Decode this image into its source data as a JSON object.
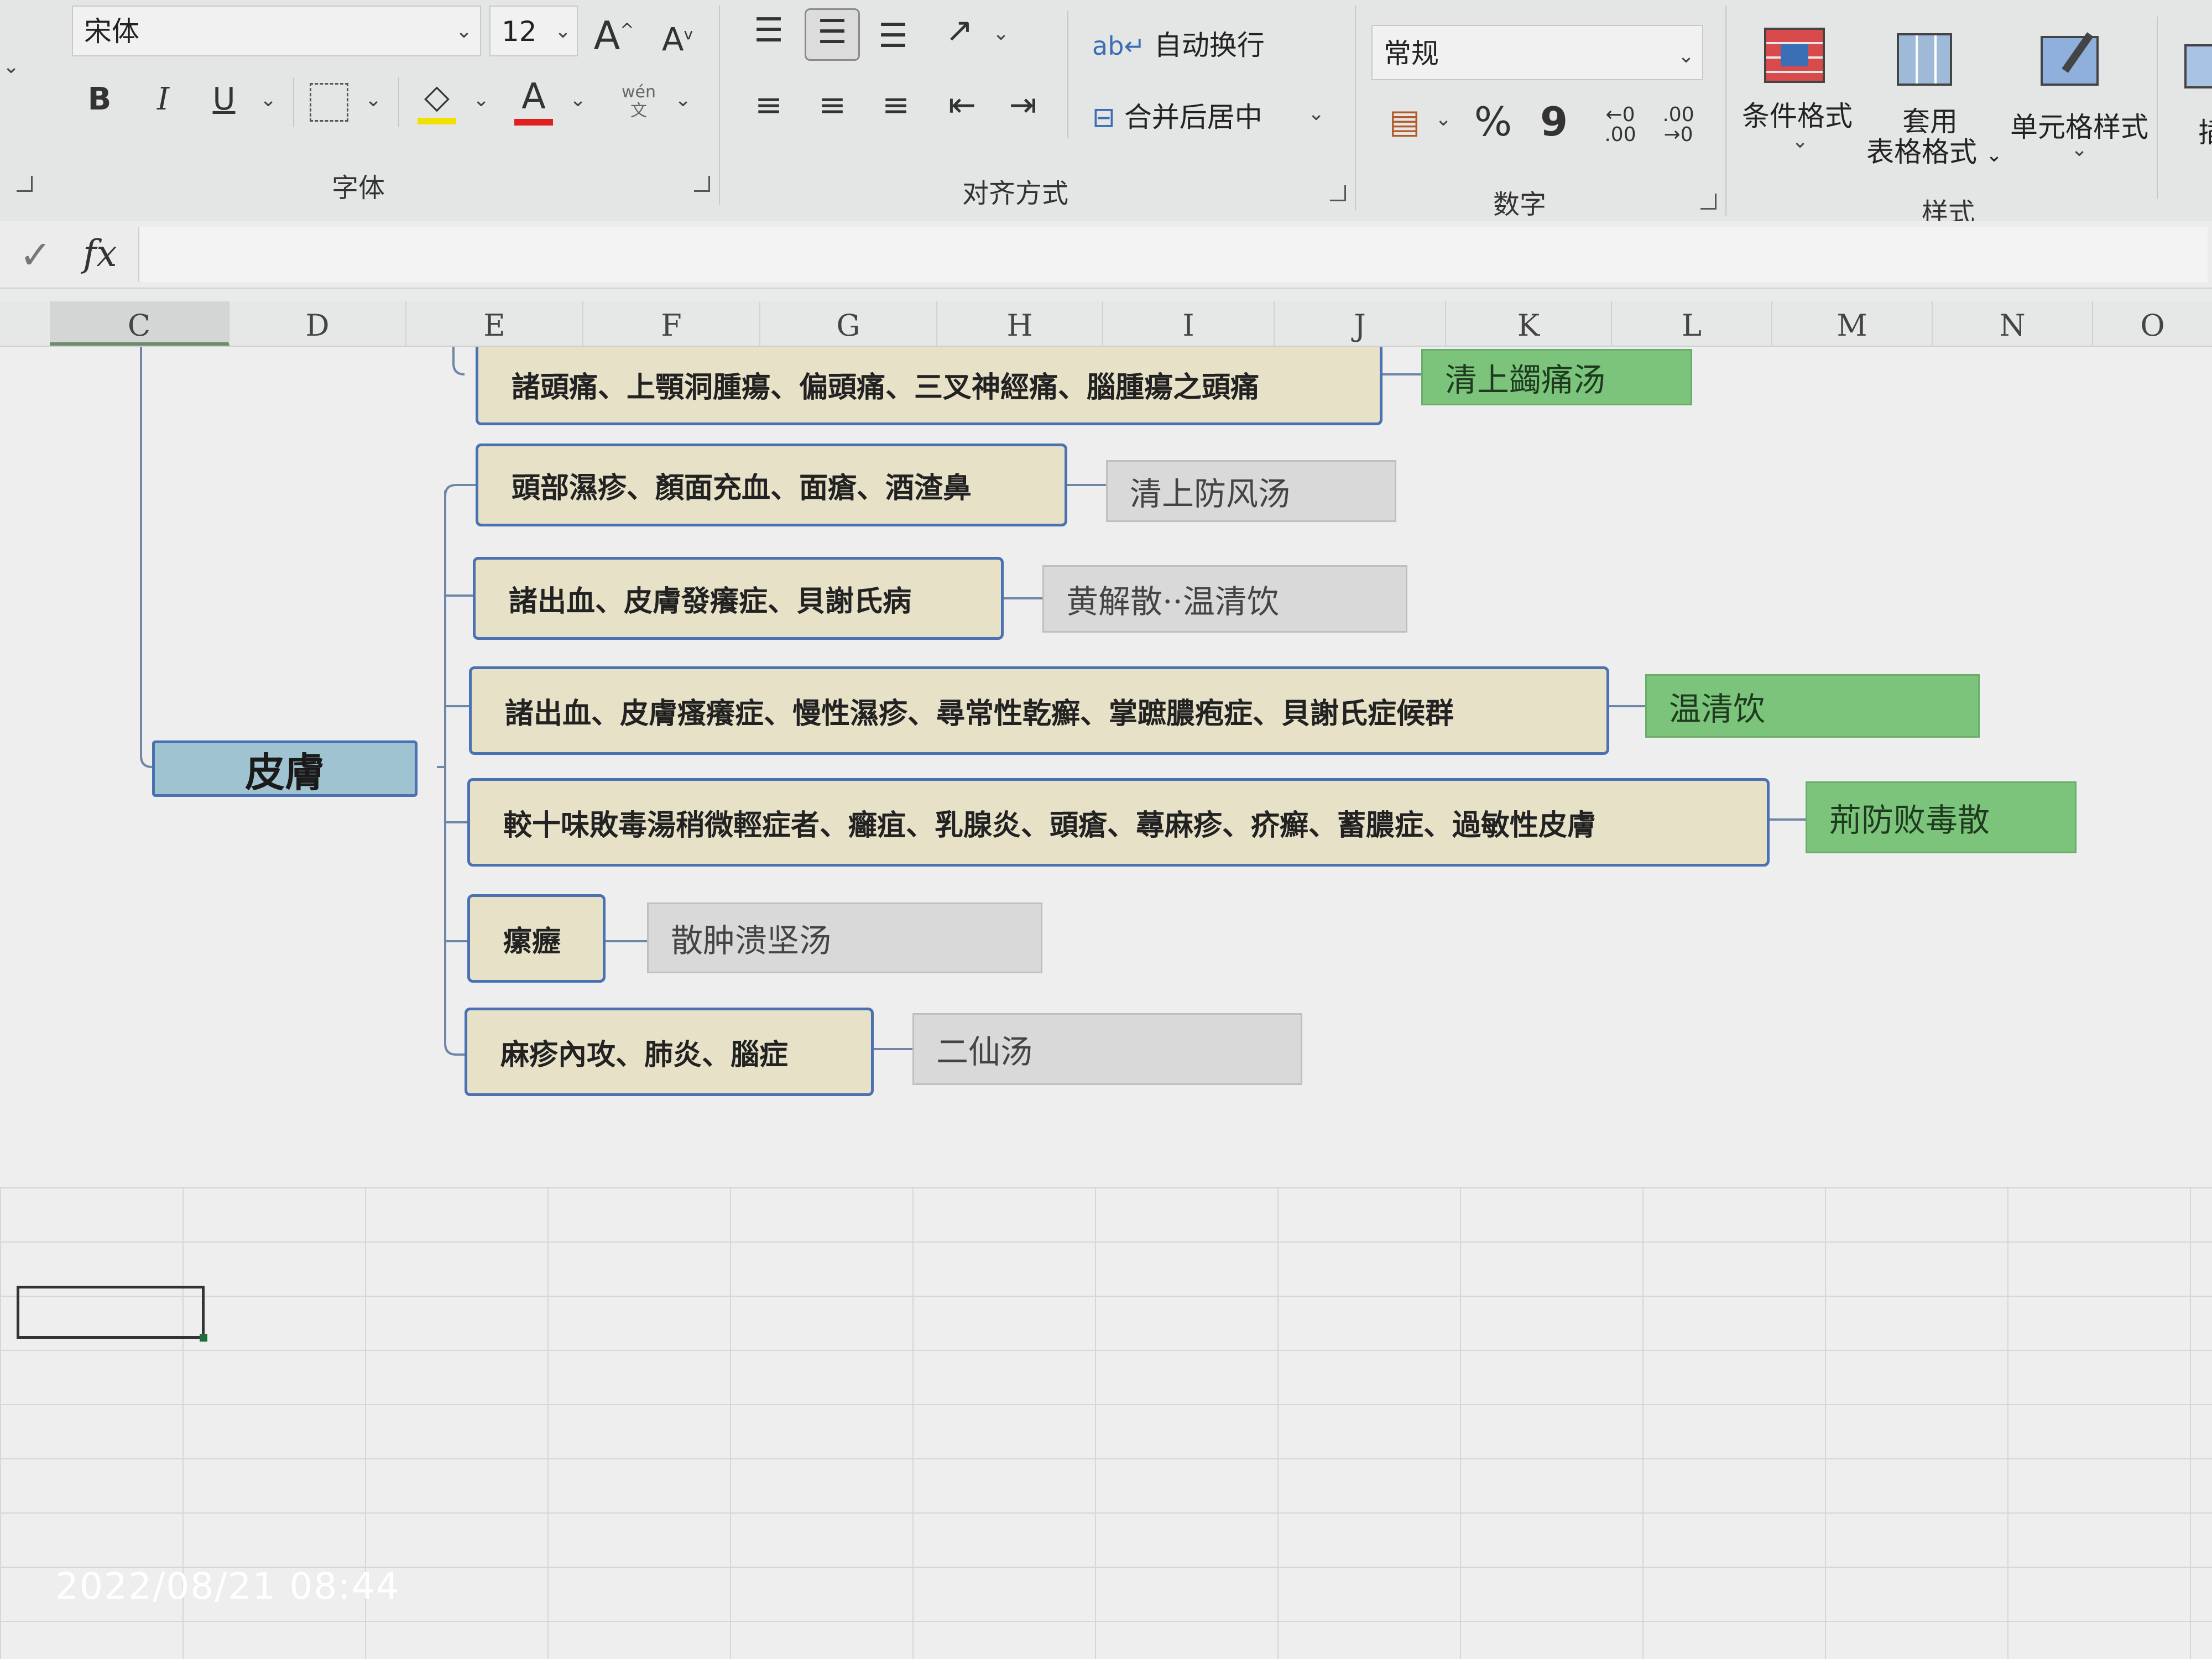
{
  "ribbon": {
    "font_name": "宋体",
    "font_size": "12",
    "grow_font_label": "A",
    "shrink_font_label": "A",
    "bold_label": "B",
    "italic_label": "I",
    "underline_label": "U",
    "font_color_label": "A",
    "phonetic_label": "wén",
    "phonetic_sub": "文",
    "wrap_text_label": "自动换行",
    "merge_center_label": "合并后居中",
    "number_format": "常规",
    "percent_label": "%",
    "comma_label": "9",
    "groups": {
      "font": "字体",
      "alignment": "对齐方式",
      "number": "数字",
      "styles": "样式"
    },
    "conditional_format_label": "条件格式",
    "table_format_label_1": "套用",
    "table_format_label_2": "表格格式",
    "cell_styles_label": "单元格样式",
    "insert_label_partial": "插",
    "colors": {
      "font_color_underline": "#e02020",
      "highlight_underline": "#f1e000"
    }
  },
  "formula_bar": {
    "fx_label": "fx",
    "check_label": "✓"
  },
  "columns": [
    "C",
    "D",
    "E",
    "F",
    "G",
    "H",
    "I",
    "J",
    "K",
    "L",
    "M",
    "N",
    "O"
  ],
  "tree": {
    "root": "皮膚",
    "branches": [
      {
        "symptoms": "諸頭痛、上顎洞腫瘍、偏頭痛、三叉神經痛、腦腫瘍之頭痛",
        "remedy": "清上蠲痛汤",
        "remedy_style": "green"
      },
      {
        "symptoms": "頭部濕疹、顏面充血、面瘡、酒渣鼻",
        "remedy": "清上防风汤",
        "remedy_style": "gray"
      },
      {
        "symptoms": "諸出血、皮膚發癢症、貝謝氏病",
        "remedy": "黄解散··温清饮",
        "remedy_style": "gray"
      },
      {
        "symptoms": "諸出血、皮膚瘙癢症、慢性濕疹、尋常性乾癬、掌蹠膿疱症、貝謝氏症候群",
        "remedy": "温清饮",
        "remedy_style": "green"
      },
      {
        "symptoms": "較十味敗毒湯稍微輕症者、癰疽、乳腺炎、頭瘡、蕁麻疹、疥癬、蓄膿症、過敏性皮膚",
        "remedy": "荊防败毒散",
        "remedy_style": "green"
      },
      {
        "symptoms": "瘰癧",
        "remedy": "散肿溃坚汤",
        "remedy_style": "gray"
      },
      {
        "symptoms": "麻疹內攻、肺炎、腦症",
        "remedy": "二仙汤",
        "remedy_style": "gray"
      }
    ]
  },
  "timestamp": "2022/08/21 08:44"
}
